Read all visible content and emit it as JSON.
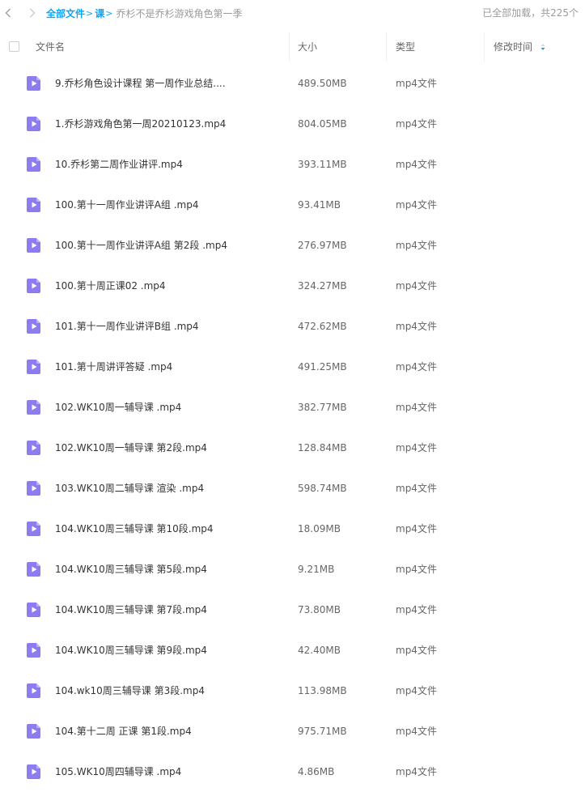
{
  "breadcrumb": {
    "root": "全部文件",
    "parent": "课",
    "current": "乔杉不是乔杉游戏角色第一季"
  },
  "status": {
    "loaded_text": "已全部加载，共225个"
  },
  "table": {
    "columns": {
      "name": "文件名",
      "size": "大小",
      "type": "类型",
      "mtime": "修改时间"
    },
    "rows": [
      {
        "name": "9.乔杉角色设计课程 第一周作业总结....",
        "size": "489.50MB",
        "type": "mp4文件"
      },
      {
        "name": "1.乔杉游戏角色第一周20210123.mp4",
        "size": "804.05MB",
        "type": "mp4文件"
      },
      {
        "name": "10.乔杉第二周作业讲评.mp4",
        "size": "393.11MB",
        "type": "mp4文件"
      },
      {
        "name": "100.第十一周作业讲评A组 .mp4",
        "size": "93.41MB",
        "type": "mp4文件"
      },
      {
        "name": "100.第十一周作业讲评A组 第2段 .mp4",
        "size": "276.97MB",
        "type": "mp4文件"
      },
      {
        "name": "100.第十周正课02 .mp4",
        "size": "324.27MB",
        "type": "mp4文件"
      },
      {
        "name": "101.第十一周作业讲评B组 .mp4",
        "size": "472.62MB",
        "type": "mp4文件"
      },
      {
        "name": "101.第十周讲评答疑 .mp4",
        "size": "491.25MB",
        "type": "mp4文件"
      },
      {
        "name": "102.WK10周一辅导课 .mp4",
        "size": "382.77MB",
        "type": "mp4文件"
      },
      {
        "name": "102.WK10周一辅导课 第2段.mp4",
        "size": "128.84MB",
        "type": "mp4文件"
      },
      {
        "name": "103.WK10周二辅导课 渲染 .mp4",
        "size": "598.74MB",
        "type": "mp4文件"
      },
      {
        "name": "104.WK10周三辅导课 第10段.mp4",
        "size": "18.09MB",
        "type": "mp4文件"
      },
      {
        "name": "104.WK10周三辅导课 第5段.mp4",
        "size": "9.21MB",
        "type": "mp4文件"
      },
      {
        "name": "104.WK10周三辅导课 第7段.mp4",
        "size": "73.80MB",
        "type": "mp4文件"
      },
      {
        "name": "104.WK10周三辅导课 第9段.mp4",
        "size": "42.40MB",
        "type": "mp4文件"
      },
      {
        "name": "104.wk10周三辅导课 第3段.mp4",
        "size": "113.98MB",
        "type": "mp4文件"
      },
      {
        "name": "104.第十二周 正课 第1段.mp4",
        "size": "975.71MB",
        "type": "mp4文件"
      },
      {
        "name": "105.WK10周四辅导课 .mp4",
        "size": "4.86MB",
        "type": "mp4文件"
      }
    ]
  },
  "icons": {
    "back": "chevron-left-icon",
    "forward": "chevron-right-icon",
    "file": "video-file-icon",
    "sort": "sort-arrow-icon"
  },
  "colors": {
    "accent": "#06a7ff",
    "file_icon": "#8c7cf0"
  }
}
